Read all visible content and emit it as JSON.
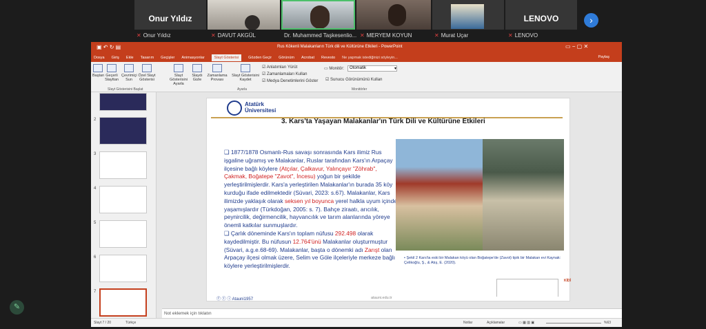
{
  "meeting": {
    "participants": [
      {
        "name": "Onur Yıldız",
        "caption": "Onur Yıldız",
        "has_video": false
      },
      {
        "name": "",
        "caption": "DAVUT AKGÜL",
        "has_video": true
      },
      {
        "name": "",
        "caption": "Dr. Muhammed Taşkesenlio...",
        "has_video": true
      },
      {
        "name": "",
        "caption": "MERYEM KOYUN",
        "has_video": true
      },
      {
        "name": "",
        "caption": "Murat Uçar",
        "has_video": true
      },
      {
        "name": "LENOVO",
        "caption": "LENOVO",
        "has_video": false
      }
    ]
  },
  "ppt": {
    "window_title": "Rus Kökenli Malakanların Türk dili ve Kültürüne Etkileri - PowerPoint",
    "tabs": [
      "Dosya",
      "Giriş",
      "Ekle",
      "Tasarım",
      "Geçişler",
      "Animasyonlar",
      "Slayt Gösterisi",
      "Gözden Geçir",
      "Görünüm",
      "Acrobat",
      "Revesto"
    ],
    "active_tab": "Slayt Gösterisi",
    "tell_me": "Ne yapmak istediğinizi söyleyin...",
    "share": "Paylaş",
    "ribbon_buttons": [
      "Baştan",
      "Geçerli Slayttan",
      "Çevrimiçi Sun",
      "Özel Slayt Gösterisi",
      "Slayt Gösterisini Ayarla",
      "Slaydı Gizle",
      "Zamanlama Provası",
      "Slayt Gösterisini Kaydet"
    ],
    "checkboxes": [
      "Anlatımları Yürüt",
      "Zamanlamaları Kullan",
      "Medya Denetimlerini Göster"
    ],
    "monitor_label": "Monitör:",
    "monitor_value": "Otomatik",
    "presenter_view": "Sunucu Görünümünü Kullan",
    "group_labels": [
      "Slayt Gösterisini Başlat",
      "Ayarla",
      "Monitörler"
    ],
    "slide_numbers": [
      "2",
      "3",
      "4",
      "5",
      "6",
      "7"
    ],
    "notes_placeholder": "Not eklemek için tıklatın",
    "status": {
      "slide": "Slayt 7 / 20",
      "lang": "Türkçe",
      "notes": "Notlar",
      "comments": "Açıklamalar",
      "zoom": "%63"
    }
  },
  "slide": {
    "logo_line1": "Atatürk",
    "logo_line2": "Üniversitesi",
    "title": "3. Kars'ta Yaşayan Malakanlar'ın Türk Dili ve Kültürüne Etkileri",
    "bullet1": "1877/1878 Osmanlı-Rus savaşı sonrasında Kars ilimiz Rus işgaline uğramış ve Malakanlar, Ruslar tarafından Kars'ın Arpaçay ilçesine bağlı köylere",
    "bullet1_red": "(Atçılar, Çalkavur, Yalınçayır \"Zöhrab\", Çakmak, Boğatepe \"Zavot\", İncesu)",
    "bullet1_b": "yoğun bir şekilde yerleştirilmişlerdir. Kars'a yerleştirilen Malakanlar'ın burada 35 köy kurduğu ifade edilmektedir (Süvari, 2023: s.67). Malakanlar, Kars ilimizde yaklaşık olarak",
    "bullet1_red2": "seksen yıl boyunca",
    "bullet1_c": "yerel halkla uyum içinde yaşamışlardır (Türkdoğan, 2005: s. 7). Bahçe ziraatı, arıcılık, peynircilik, değirmencilik, hayvancılık ve tarım alanlarında yöreye önemli katkılar sunmuşlardır.",
    "bullet2_a": "Çarlık döneminde Kars'ın toplam nüfusu",
    "bullet2_red1": "292.498",
    "bullet2_b": "olarak kaydedilmiştir. Bu nüfusun",
    "bullet2_red2": "12.764'ünü",
    "bullet2_c": "Malakanlar oluşturmuştur (Süvari, a.g.e.68-69). Malakanlar, başta o dönemki adı",
    "bullet2_red3": "Zarışt",
    "bullet2_d": "olan Arpaçay ilçesi olmak üzere, Selim ve Göle ilçeleriyle merkeze bağlı köylere yerleştirilmişlerdir.",
    "caption": "Şekil 2 Kars'ta eski bir Malakan köyü olan Boğatepe'de (Zavot) tipik bir Malakan evi Kaynak: Çelikoğlu, Ş., & Atış, E. (2020).",
    "footer_handle": "Atauni1957",
    "footer_url": "atauni.edu.tr",
    "kidi": "KİDİ"
  },
  "colors": {
    "accent": "#c43e1c",
    "red_text": "#d02020",
    "blue_text": "#1f3b8c",
    "gold": "#c8a050"
  }
}
